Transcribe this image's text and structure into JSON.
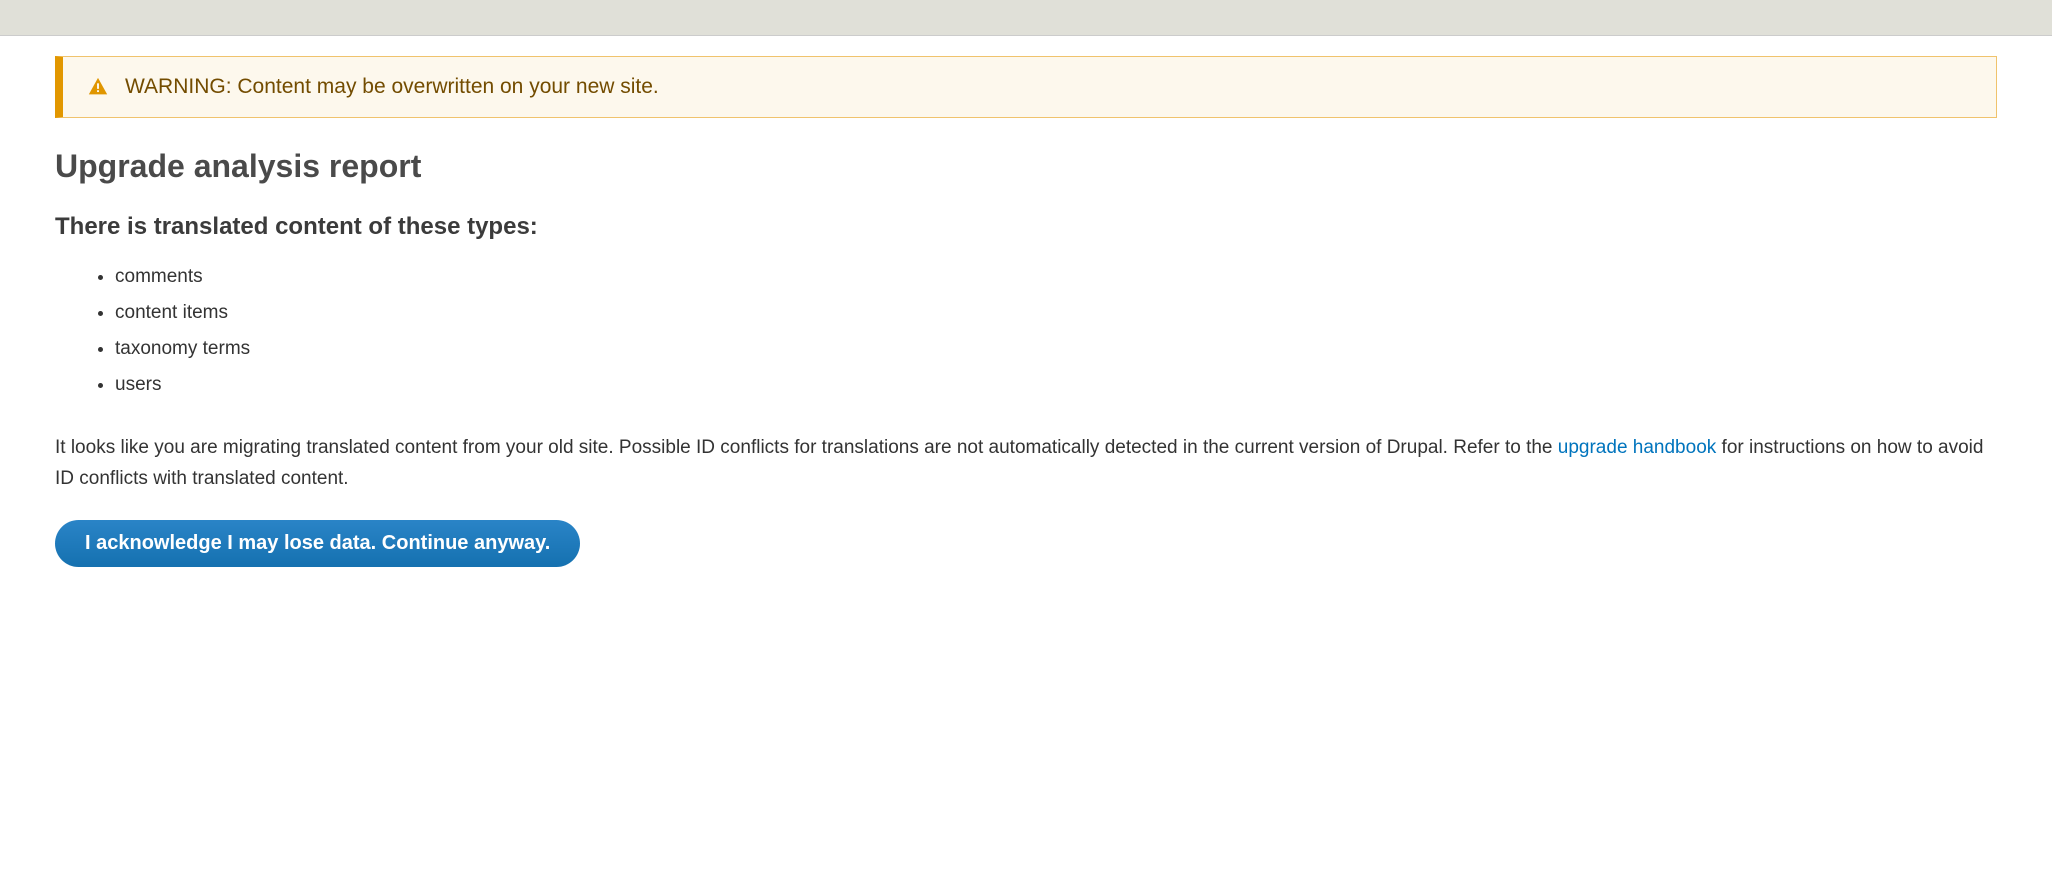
{
  "warning": {
    "text": "WARNING: Content may be overwritten on your new site."
  },
  "page": {
    "title": "Upgrade analysis report",
    "subheading": "There is translated content of these types:",
    "content_types": [
      "comments",
      "content items",
      "taxonomy terms",
      "users"
    ],
    "description_part1": "It looks like you are migrating translated content from your old site. Possible ID conflicts for translations are not automatically detected in the current version of Drupal. Refer to the ",
    "description_link_text": "upgrade handbook",
    "description_part2": " for instructions on how to avoid ID conflicts with translated content.",
    "continue_button_label": "I acknowledge I may lose data. Continue anyway."
  }
}
